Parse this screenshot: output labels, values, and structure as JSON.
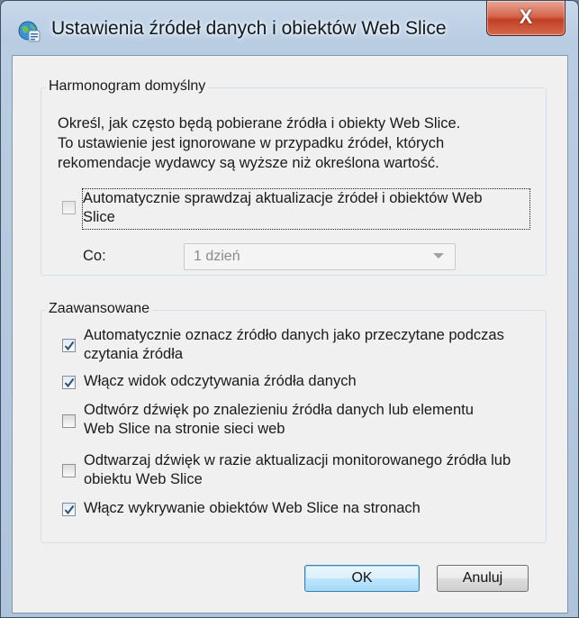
{
  "window": {
    "title": "Ustawienia źródeł danych i obiektów Web Slice",
    "close_glyph": "X"
  },
  "schedule": {
    "legend": "Harmonogram domyślny",
    "description_line1": "Określ, jak często będą pobierane źródła i obiekty Web Slice.",
    "description_line2": "To ustawienie jest ignorowane w przypadku źródeł, których",
    "description_line3": "rekomendacje wydawcy są wyższe niż określona wartość.",
    "auto_check": {
      "label_line1": "Automatycznie sprawdzaj aktualizacje źródeł i obiektów Web",
      "label_line2": "Slice",
      "checked": false
    },
    "frequency_label": "Co:",
    "frequency_value": "1 dzień"
  },
  "advanced": {
    "legend": "Zaawansowane",
    "options": [
      {
        "line1": "Automatycznie oznacz źródło danych jako przeczytane podczas",
        "line2": "czytania źródła",
        "checked": true
      },
      {
        "line1": "Włącz widok odczytywania źródła danych",
        "line2": "",
        "checked": true
      },
      {
        "line1": "Odtwórz dźwięk po znalezieniu źródła danych lub elementu",
        "line2": "Web Slice na stronie sieci web",
        "checked": false
      },
      {
        "line1": "Odtwarzaj dźwięk w razie aktualizacji monitorowanego źródła lub",
        "line2": "obiektu Web Slice",
        "checked": false
      },
      {
        "line1": "Włącz wykrywanie obiektów Web Slice na stronach",
        "line2": "",
        "checked": true
      }
    ]
  },
  "buttons": {
    "ok": "OK",
    "cancel": "Anuluj"
  },
  "colors": {
    "titlebar": "#b9cde2",
    "close_button": "#c13f25",
    "dialog_bg": "#f0f0f0",
    "default_button": "#bee6fd"
  },
  "icons": {
    "title": "feed-globe-icon",
    "check": "checkmark-icon",
    "close": "close-icon"
  }
}
